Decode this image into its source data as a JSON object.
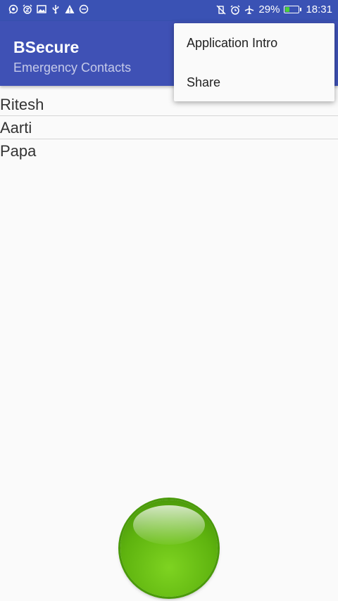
{
  "status_bar": {
    "left_icons": [
      "whatsapp-icon",
      "alarm-snooze-icon",
      "image-icon",
      "usb-icon",
      "warning-icon",
      "minus-circle-icon"
    ],
    "right_icons": [
      "muted-vibrate-icon",
      "alarm-icon",
      "airplane-icon"
    ],
    "battery_percent": "29%",
    "battery_level": 0.29,
    "time": "18:31"
  },
  "app_bar": {
    "title": "BSecure",
    "subtitle": "Emergency Contacts"
  },
  "menu": {
    "items": [
      {
        "label": "Application Intro"
      },
      {
        "label": "Share"
      }
    ]
  },
  "contacts": [
    {
      "name": "Ritesh"
    },
    {
      "name": "Aarti"
    },
    {
      "name": "Papa"
    }
  ],
  "colors": {
    "primary": "#3f51b5",
    "status_bar": "#3a52b4",
    "panic_button": "#5fb40f",
    "battery": "#4cd137"
  }
}
